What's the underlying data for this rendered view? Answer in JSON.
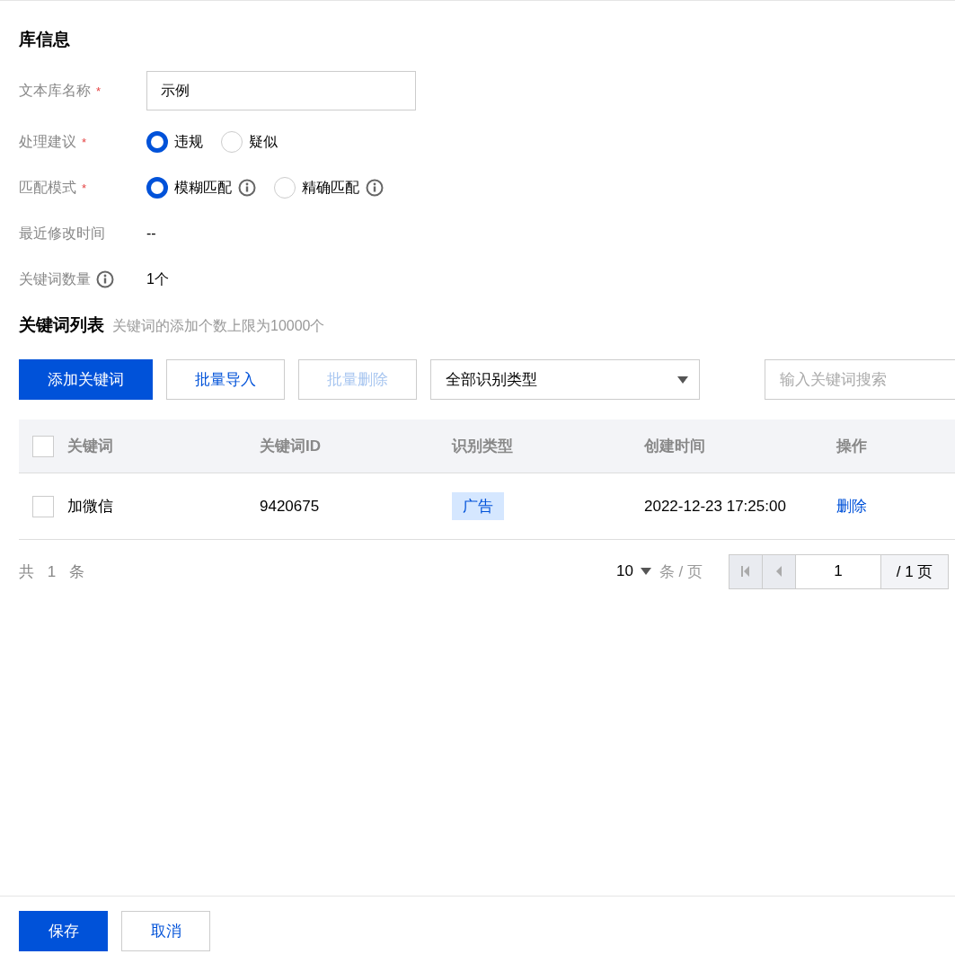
{
  "section_title": "库信息",
  "form": [
    {
      "kind": "input",
      "label": "文本库名称",
      "required_mark": "*",
      "value": "示例"
    },
    {
      "kind": "radio",
      "label": "处理建议",
      "required_mark": "*",
      "options": [
        {
          "label": "违规",
          "selected": true,
          "info": false
        },
        {
          "label": "疑似",
          "selected": false,
          "info": false
        }
      ]
    },
    {
      "kind": "radio",
      "label": "匹配模式",
      "required_mark": "*",
      "options": [
        {
          "label": "模糊匹配",
          "selected": true,
          "info": true
        },
        {
          "label": "精确匹配",
          "selected": false,
          "info": true
        }
      ]
    },
    {
      "kind": "text",
      "label": "最近修改时间",
      "value": "--"
    },
    {
      "kind": "text",
      "label": "关键词数量",
      "info": true,
      "value": "1个"
    }
  ],
  "list_title": "关键词列表",
  "list_hint": "关键词的添加个数上限为10000个",
  "toolbar": {
    "buttons": [
      {
        "kind": "primary",
        "label": "添加关键词",
        "disabled": false
      },
      {
        "kind": "default",
        "label": "批量导入",
        "disabled": false
      },
      {
        "kind": "default",
        "label": "批量删除",
        "disabled": true
      }
    ],
    "type_select": "全部识别类型",
    "search": {
      "placeholder": "输入关键词搜索"
    }
  },
  "table": {
    "all_checked": false,
    "columns": [
      "关键词",
      "关键词ID",
      "识别类型",
      "创建时间",
      "操作"
    ],
    "rows": [
      {
        "checked": false,
        "keyword": "加微信",
        "id": "9420675",
        "type": "广告",
        "created": "2022-12-23 17:25:00",
        "action": "删除"
      }
    ]
  },
  "pagination": {
    "total_prefix": "共",
    "total": "1",
    "total_suffix": "条",
    "page_size": "10",
    "page_size_unit": "条 / 页",
    "page": "1",
    "page_total": "/ 1 页"
  },
  "footer": {
    "buttons": [
      {
        "kind": "primary",
        "label": "保存"
      },
      {
        "kind": "default",
        "label": "取消"
      }
    ]
  }
}
